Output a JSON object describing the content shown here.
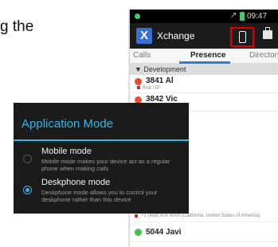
{
  "document": {
    "partial_text": "g the"
  },
  "phone": {
    "status": {
      "time": "09:47",
      "signal": "↗"
    },
    "actionbar": {
      "title": "Xchange",
      "logo": "X"
    },
    "tabs": [
      {
        "label": "Calls"
      },
      {
        "label": "Presence"
      },
      {
        "label": "Directory"
      }
    ],
    "group": {
      "label": "▼ Development"
    },
    "contacts": [
      {
        "name": "3841 Al",
        "sub": "Rob ITP",
        "color": "#e8502d"
      },
      {
        "name": "3842 Vic",
        "sub": "",
        "color": "#e8502d"
      },
      {
        "name": "",
        "sub": "+1 (408) 600 6000 (California, United States of America)",
        "color": "#d03030"
      },
      {
        "name": "5044 Javi",
        "sub": "",
        "color": "#45c24d"
      }
    ]
  },
  "dialog": {
    "title": "Application Mode",
    "options": [
      {
        "title": "Mobile mode",
        "description": "Mobile mode makes your device act as a regular phone when making calls",
        "selected": false
      },
      {
        "title": "Deskphone mode",
        "description": "Deskphone mode allows you to control your deskphone rather than this device",
        "selected": true
      }
    ]
  },
  "colors": {
    "accent": "#35b5e5",
    "highlight_box": "#e00000",
    "dialog_bg": "#1b1b1b"
  }
}
